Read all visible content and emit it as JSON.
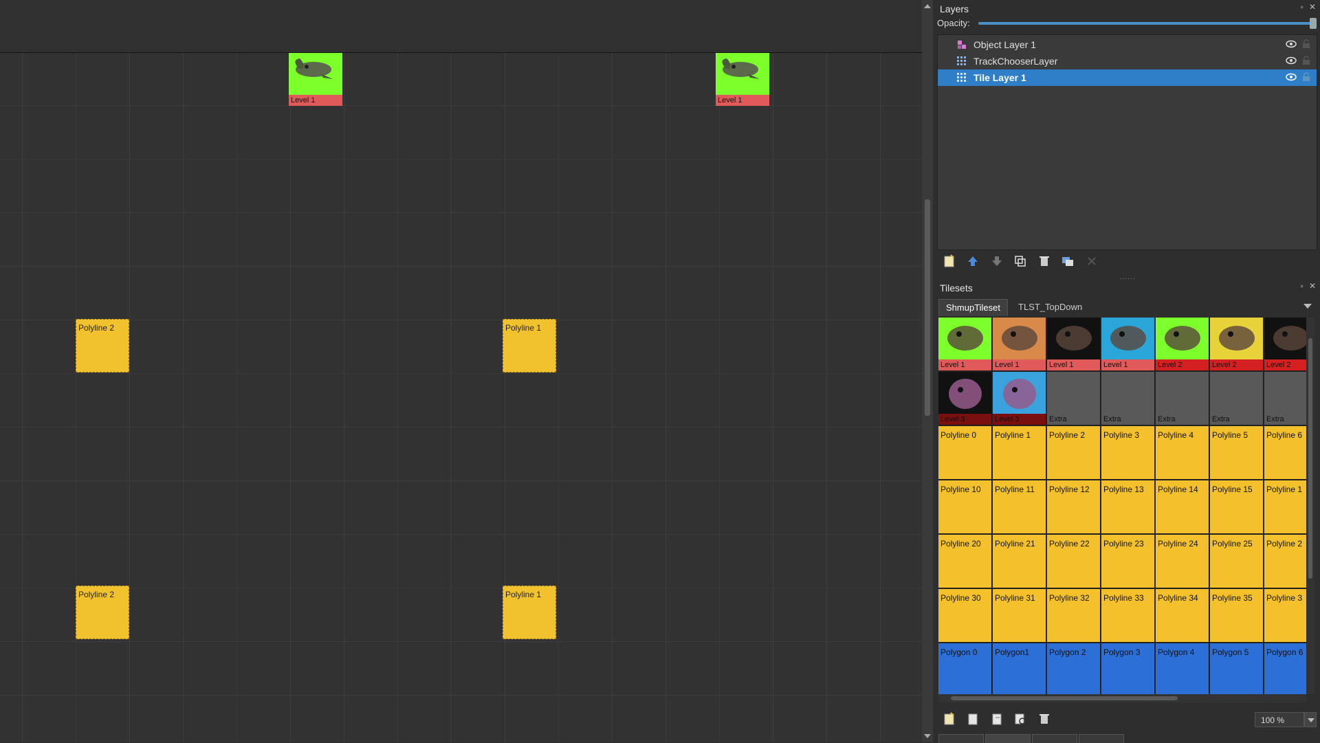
{
  "map": {
    "tiles": [
      {
        "kind": "green",
        "label": "Level 1"
      },
      {
        "kind": "green",
        "label": "Level 1"
      },
      {
        "kind": "yellow",
        "label": "Polyline 2"
      },
      {
        "kind": "yellow",
        "label": "Polyline 1"
      },
      {
        "kind": "yellow",
        "label": "Polyline 2"
      },
      {
        "kind": "yellow",
        "label": "Polyline 1"
      }
    ]
  },
  "layers": {
    "title": "Layers",
    "opacity_label": "Opacity:",
    "opacity": 1.0,
    "items": [
      {
        "name": "Object Layer 1",
        "icon": "object-layer-icon"
      },
      {
        "name": "TrackChooserLayer",
        "icon": "tile-layer-icon"
      },
      {
        "name": "Tile Layer 1",
        "icon": "tile-layer-icon",
        "selected": true
      }
    ],
    "toolbar": [
      "new-layer-icon",
      "move-up-icon",
      "move-down-icon",
      "duplicate-icon",
      "delete-icon",
      "merge-icon",
      "close-icon"
    ]
  },
  "tilesets": {
    "title": "Tilesets",
    "tabs": [
      "ShmupTileset",
      "TLST_TopDown"
    ],
    "row1": [
      {
        "bar": "Level 1",
        "bg": "#7cff2a",
        "barColor": "#e05a5a"
      },
      {
        "bar": "Level 1",
        "bg": "#d98a4a",
        "barColor": "#e05a5a"
      },
      {
        "bar": "Level 1",
        "bg": "#111111",
        "barColor": "#e05a5a"
      },
      {
        "bar": "Level 1",
        "bg": "#2aa6d8",
        "barColor": "#e05a5a"
      },
      {
        "bar": "Level 2",
        "bg": "#7cff2a",
        "barColor": "#d42020"
      },
      {
        "bar": "Level 2",
        "bg": "#e8d23a",
        "barColor": "#d42020"
      },
      {
        "bar": "Level 2",
        "bg": "#111111",
        "barColor": "#d42020"
      }
    ],
    "row2": [
      {
        "bar": "Level 3",
        "bg": "#111111",
        "barColor": "#7a0f0f"
      },
      {
        "bar": "Level 3",
        "bg": "#3aa2dc",
        "barColor": "#7a0f0f"
      },
      {
        "bar": "Extra"
      },
      {
        "bar": "Extra"
      },
      {
        "bar": "Extra"
      },
      {
        "bar": "Extra"
      },
      {
        "bar": "Extra"
      }
    ],
    "polyline_rows": [
      [
        "Polyline 0",
        "Polyline 1",
        "Polyline 2",
        "Polyline 3",
        "Polyline 4",
        "Polyline 5",
        "Polyline 6"
      ],
      [
        "Polyline 10",
        "Polyline 11",
        "Polyline 12",
        "Polyline 13",
        "Polyline 14",
        "Polyline 15",
        "Polyline 1"
      ],
      [
        "Polyline 20",
        "Polyline 21",
        "Polyline 22",
        "Polyline 23",
        "Polyline 24",
        "Polyline 25",
        "Polyline 2"
      ],
      [
        "Polyline 30",
        "Polyline 31",
        "Polyline 32",
        "Polyline 33",
        "Polyline 34",
        "Polyline 35",
        "Polyline 3"
      ]
    ],
    "polygon_row": [
      "Polygon 0",
      "Polygon1",
      "Polygon 2",
      "Polygon 3",
      "Polygon 4",
      "Polygon 5",
      "Polygon 6"
    ],
    "toolbar": [
      "new-tileset-icon",
      "import-tileset-icon",
      "export-tileset-icon",
      "tileset-properties-icon",
      "delete-tileset-icon"
    ],
    "zoom": "100 %"
  },
  "colors": {
    "selection": "#2f7fc8",
    "polyline": "#f4c12c",
    "polygon": "#2c6fd6",
    "level1_bar": "#e05a5a"
  }
}
